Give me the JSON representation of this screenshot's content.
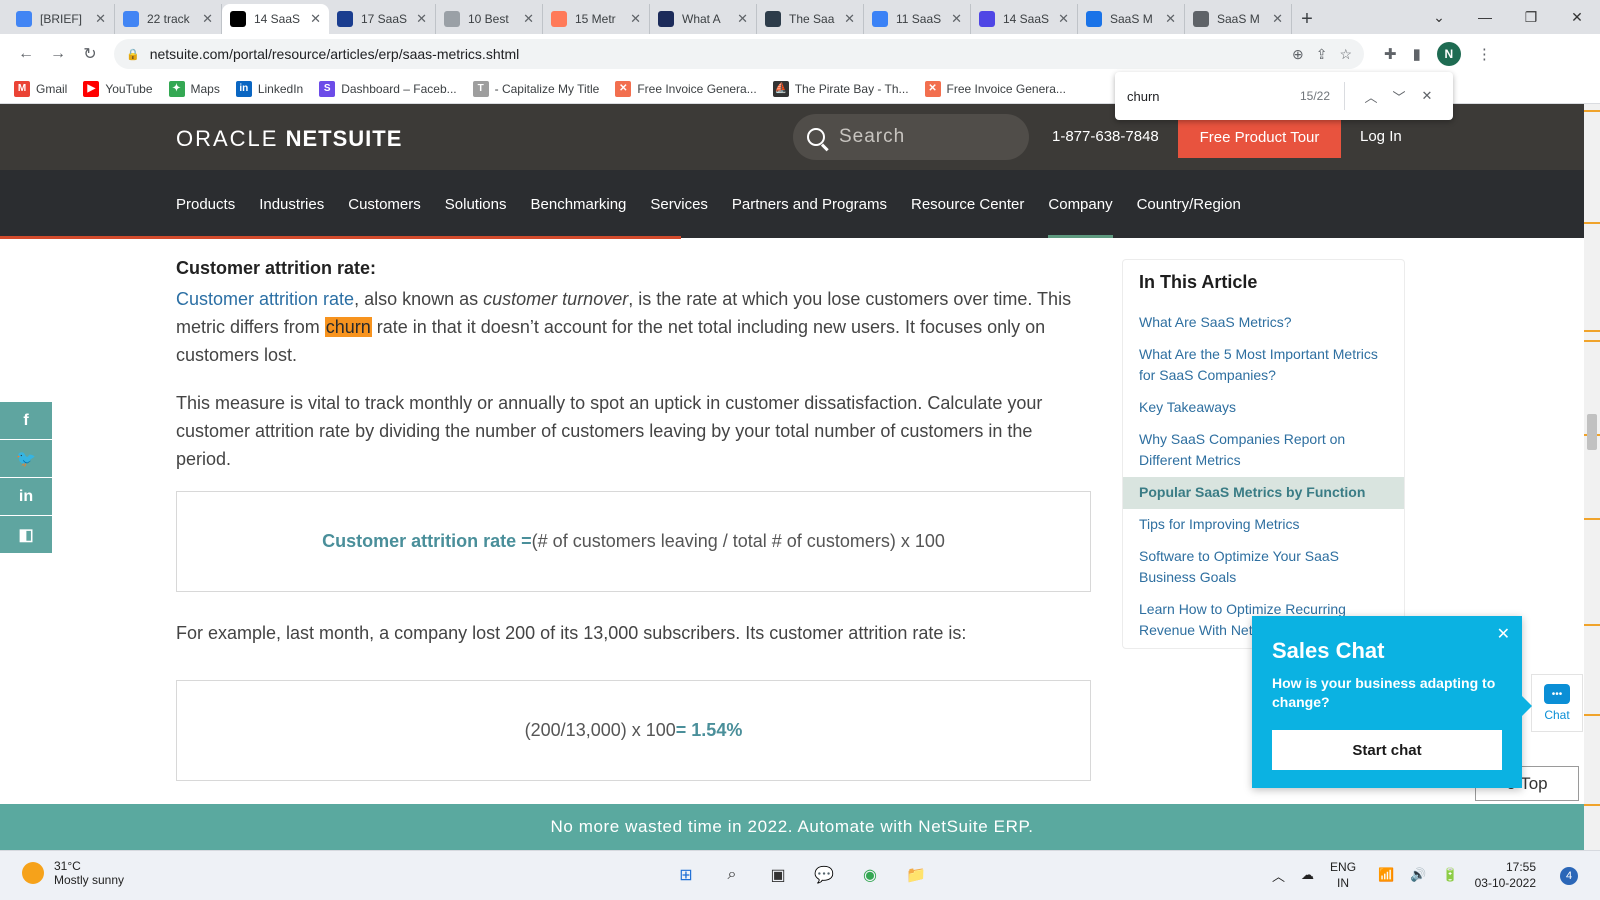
{
  "tabs": [
    {
      "title": "[BRIEF]",
      "icon": "docs-icon",
      "color": "#4285f4"
    },
    {
      "title": "22 track",
      "icon": "docs-icon",
      "color": "#4285f4"
    },
    {
      "title": "14 SaaS",
      "icon": "notion-icon",
      "color": "#000000"
    },
    {
      "title": "17 SaaS",
      "icon": "chart-icon",
      "color": "#1a3d8f"
    },
    {
      "title": "10 Best",
      "icon": "page-icon",
      "color": "#9aa0a6"
    },
    {
      "title": "15 Metr",
      "icon": "hubspot-icon",
      "color": "#ff7a59"
    },
    {
      "title": "What A",
      "icon": "b-icon",
      "color": "#1c2b5a"
    },
    {
      "title": "The Saa",
      "icon": "image-icon",
      "color": "#2d3c4a"
    },
    {
      "title": "11 SaaS",
      "icon": "chat-icon",
      "color": "#3b82f6"
    },
    {
      "title": "14 SaaS",
      "icon": "arrow-icon",
      "color": "#4f46e5"
    },
    {
      "title": "SaaS M",
      "icon": "table-icon",
      "color": "#1a73e8"
    },
    {
      "title": "SaaS M",
      "icon": "asterisk-icon",
      "color": "#5f6368"
    }
  ],
  "address": {
    "url": "netsuite.com/portal/resource/articles/erp/saas-metrics.shtml",
    "profile_initial": "N"
  },
  "bookmarks": [
    {
      "label": "Gmail",
      "color": "#ea4335",
      "glyph": "M"
    },
    {
      "label": "YouTube",
      "color": "#ff0000",
      "glyph": "▶"
    },
    {
      "label": "Maps",
      "color": "#34a853",
      "glyph": "✦"
    },
    {
      "label": "LinkedIn",
      "color": "#0a66c2",
      "glyph": "in"
    },
    {
      "label": "Dashboard – Faceb...",
      "color": "#6c4ce8",
      "glyph": "S"
    },
    {
      "label": "- Capitalize My Title",
      "color": "#9e9e9e",
      "glyph": "T"
    },
    {
      "label": "Free Invoice Genera...",
      "color": "#f26f4f",
      "glyph": "✕"
    },
    {
      "label": "The Pirate Bay - Th...",
      "color": "#333333",
      "glyph": "⛵"
    },
    {
      "label": "Free Invoice Genera...",
      "color": "#f26f4f",
      "glyph": "✕"
    }
  ],
  "find": {
    "query": "churn",
    "count": "15/22"
  },
  "header": {
    "logo_a": "ORACLE",
    "logo_b": "NETSUITE",
    "search_placeholder": "Search",
    "phone": "1-877-638-7848",
    "tour": "Free Product Tour",
    "login": "Log In"
  },
  "nav": [
    "Products",
    "Industries",
    "Customers",
    "Solutions",
    "Benchmarking",
    "Services",
    "Partners and Programs",
    "Resource Center",
    "Company",
    "Country/Region"
  ],
  "nav_current": "Company",
  "reading_progress": 0.43,
  "article": {
    "heading": "Customer attrition rate:",
    "p1_link": "Customer attrition rate",
    "p1_a": ", also known as ",
    "p1_em": "customer turnover",
    "p1_b": ", is the rate at which you lose customers over time. This metric differs from ",
    "p1_mark": "churn",
    "p1_c": " rate in that it doesn’t account for the net total including new users. It focuses only on customers lost.",
    "p2": "This measure is vital to track monthly or annually to spot an uptick in customer dissatisfaction. Calculate your customer attrition rate by dividing the number of customers leaving by your total number of customers in the period.",
    "formula_label": "Customer attrition rate =",
    "formula_body": " (# of customers leaving / total # of customers) x 100",
    "p3": "For example, last month, a company lost 200 of its 13,000 subscribers. Its customer attrition rate is:",
    "example_calc": "(200/13,000) x 100 ",
    "example_result": "= 1.54%"
  },
  "toc": {
    "title": "In This Article",
    "items": [
      "What Are SaaS Metrics?",
      "What Are the 5 Most Important Metrics for SaaS Companies?",
      "Key Takeaways",
      "Why SaaS Companies Report on Different Metrics",
      "Popular SaaS Metrics by Function",
      "Tips for Improving Metrics",
      "Software to Optimize Your SaaS Business Goals",
      "Learn How to Optimize Recurring Revenue With NetSuite"
    ],
    "selected_index": 4
  },
  "chat": {
    "title": "Sales Chat",
    "question": "How is your business adapting to change?",
    "button": "Start chat",
    "launcher": "Chat"
  },
  "back_to_top": "o Top",
  "banner": "No more wasted time in 2022. Automate with NetSuite ERP.",
  "taskbar": {
    "temp": "31°C",
    "weather": "Mostly sunny",
    "lang1": "ENG",
    "lang2": "IN",
    "time": "17:55",
    "date": "03-10-2022",
    "notifications": "4"
  }
}
